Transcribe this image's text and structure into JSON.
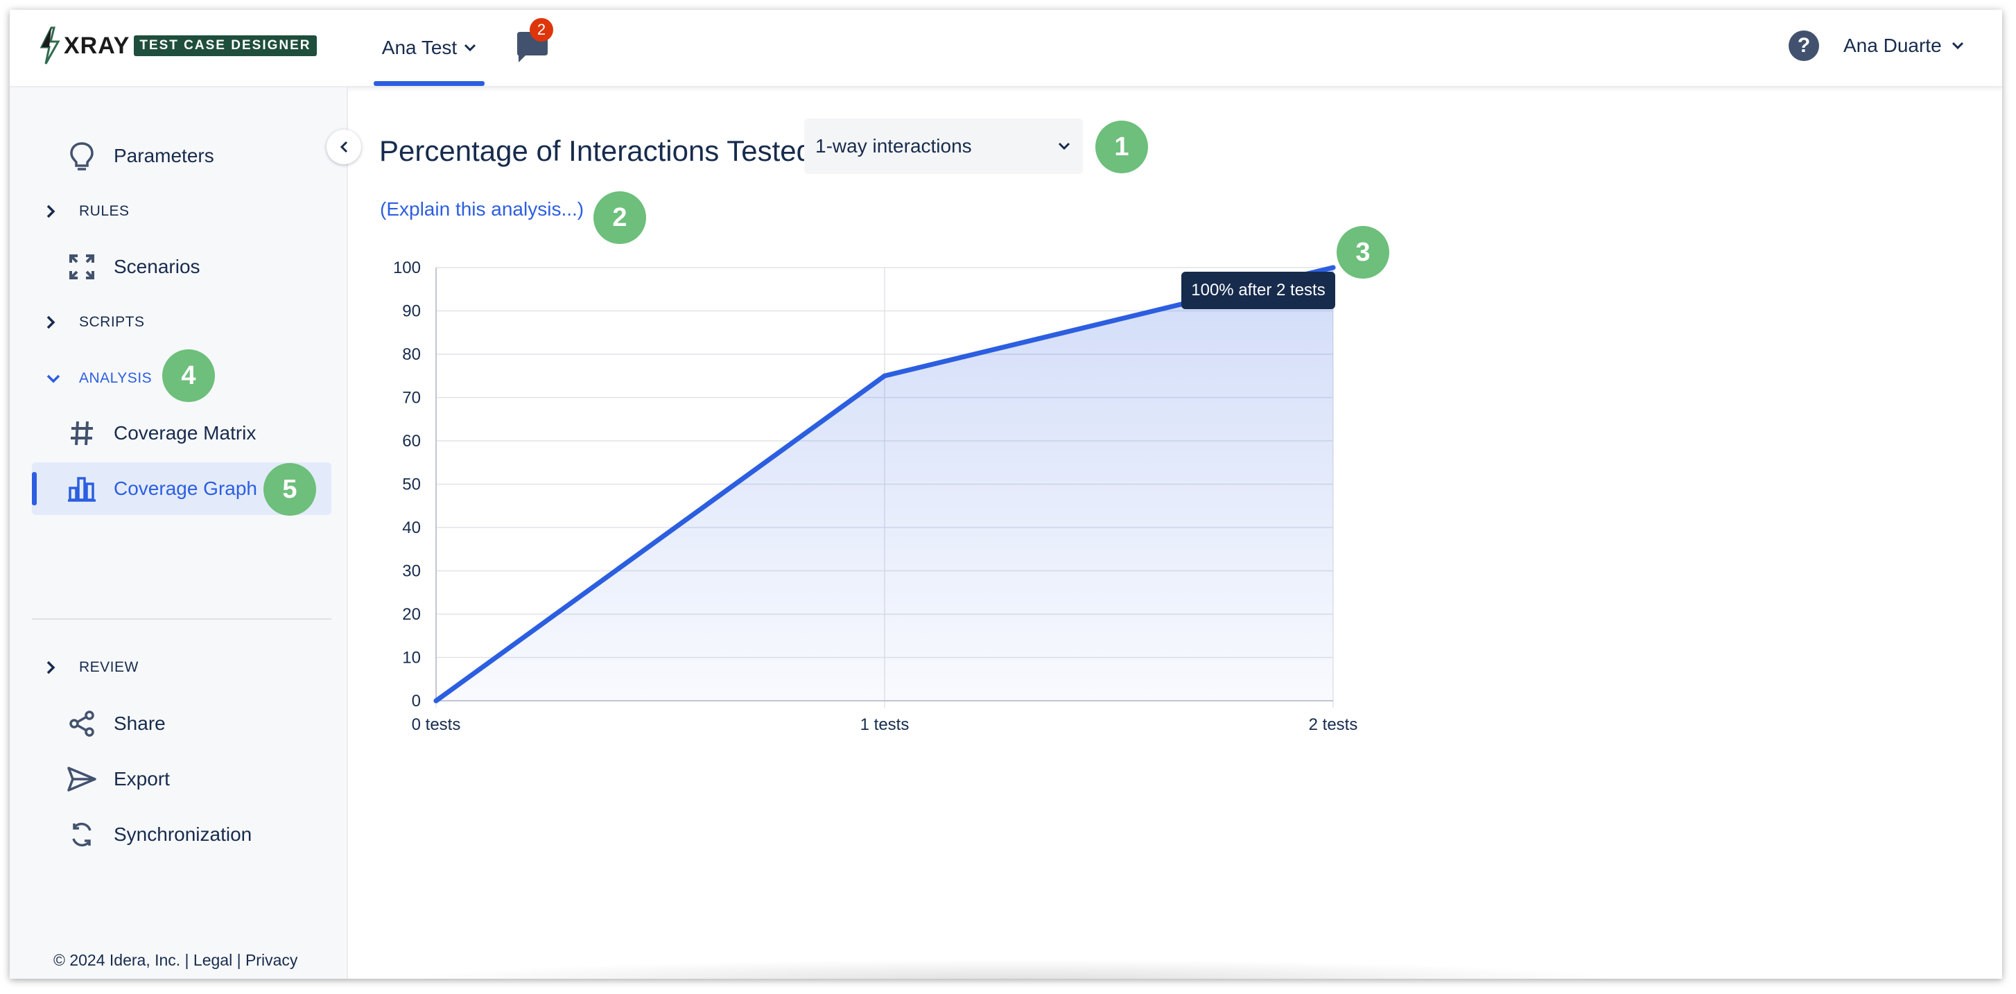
{
  "header": {
    "logo_text": "XRAY",
    "logo_badge": "TEST CASE DESIGNER",
    "project_name": "Ana Test",
    "chat_badge_count": "2",
    "help_label": "?",
    "user_name": "Ana Duarte"
  },
  "sidebar": {
    "items": [
      {
        "label": "Parameters",
        "icon": "lightbulb-icon"
      },
      {
        "label": "RULES",
        "type": "section"
      },
      {
        "label": "Scenarios",
        "icon": "expand-arrows-icon"
      },
      {
        "label": "SCRIPTS",
        "type": "section"
      },
      {
        "label": "ANALYSIS",
        "type": "section",
        "open": true
      },
      {
        "label": "Coverage Matrix",
        "icon": "hash-icon"
      },
      {
        "label": "Coverage Graph",
        "icon": "bar-chart-icon",
        "active": true
      },
      {
        "label": "REVIEW",
        "type": "section"
      },
      {
        "label": "Share",
        "icon": "share-icon"
      },
      {
        "label": "Export",
        "icon": "send-icon"
      },
      {
        "label": "Synchronization",
        "icon": "sync-icon"
      }
    ],
    "footer": "© 2024 Idera, Inc. | Legal | Privacy"
  },
  "main": {
    "title": "Percentage of Interactions Tested",
    "select_value": "1-way interactions",
    "explain_link": "(Explain this analysis...)",
    "tooltip": "100% after 2 tests"
  },
  "callouts": [
    "1",
    "2",
    "3",
    "4",
    "5"
  ],
  "colors": {
    "accent": "#2c5ee0",
    "callout": "#6dbf7b",
    "tooltip_bg": "#172b4d"
  },
  "chart_data": {
    "type": "area",
    "categories": [
      "0 tests",
      "1 tests",
      "2 tests"
    ],
    "x": [
      0,
      1,
      2
    ],
    "series": [
      {
        "values": [
          0,
          75,
          100
        ]
      }
    ],
    "yticks": [
      "0",
      "10",
      "20",
      "30",
      "40",
      "50",
      "60",
      "70",
      "80",
      "90",
      "100"
    ],
    "ylim": [
      0,
      100
    ],
    "grid": true,
    "title": "",
    "xlabel": "",
    "ylabel": ""
  }
}
